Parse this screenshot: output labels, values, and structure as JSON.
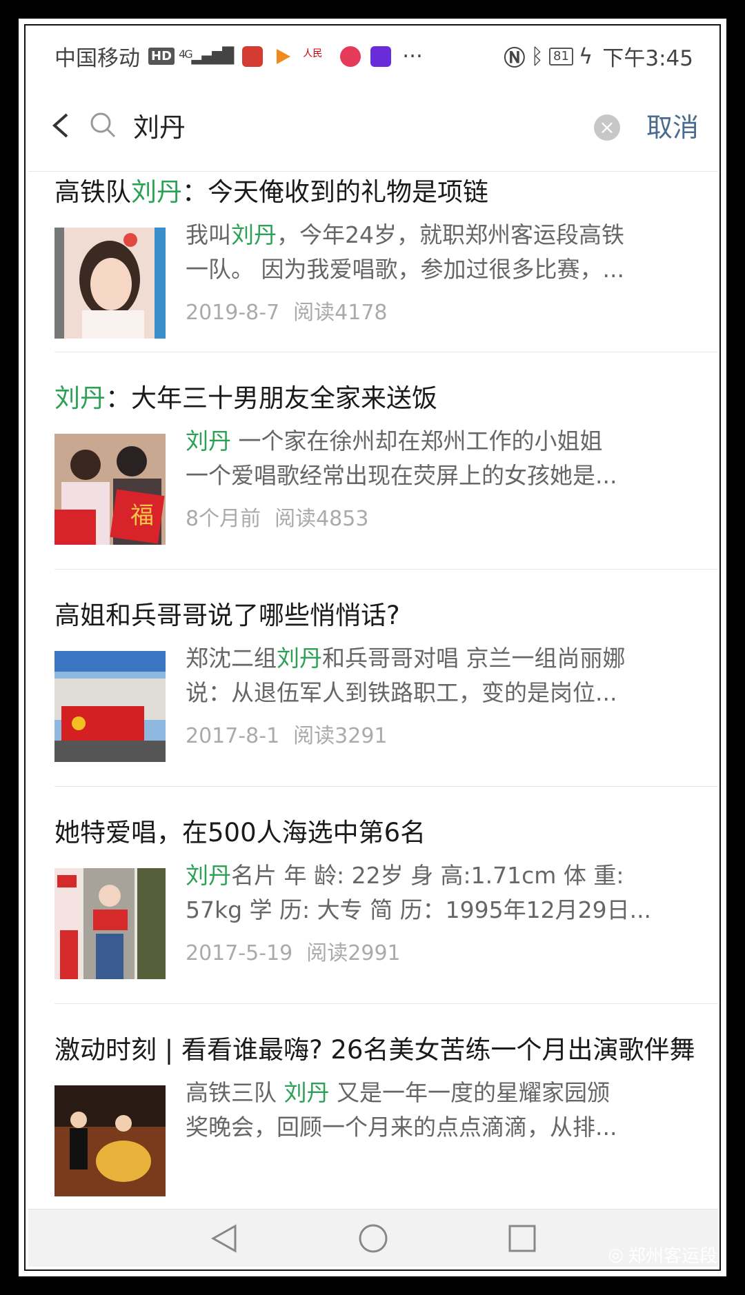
{
  "status": {
    "carrier": "中国移动",
    "hd": "HD",
    "network": "4G",
    "battery": "81",
    "time": "下午3:45",
    "more": "···"
  },
  "search": {
    "query": "刘丹",
    "clear": "×",
    "cancel": "取消"
  },
  "results": [
    {
      "title_pre": "高铁队",
      "title_hl": "刘丹",
      "title_post": "：今天俺收到的礼物是项链",
      "snip1_pre": "我叫",
      "snip1_hl": "刘丹",
      "snip1_post": "，今年24岁，就职郑州客运段高铁",
      "snip2": "一队。 因为我爱唱歌，参加过很多比赛，...",
      "date": "2019-8-7",
      "reads": "阅读4178"
    },
    {
      "title_pre": "",
      "title_hl": "刘丹",
      "title_post": "：大年三十男朋友全家来送饭",
      "snip1_pre": "",
      "snip1_hl": "刘丹",
      "snip1_post": " 一个家在徐州却在郑州工作的小姐姐",
      "snip2": "一个爱唱歌经常出现在荧屏上的女孩她是...",
      "date": "8个月前",
      "reads": "阅读4853"
    },
    {
      "title_pre": "高姐和兵哥哥说了哪些悄悄话?",
      "title_hl": "",
      "title_post": "",
      "snip1_pre": "郑沈二组",
      "snip1_hl": "刘丹",
      "snip1_post": "和兵哥哥对唱 京兰一组尚丽娜",
      "snip2": "说：从退伍军人到铁路职工，变的是岗位...",
      "date": "2017-8-1",
      "reads": "阅读3291"
    },
    {
      "title_pre": "她特爱唱，在500人海选中第6名",
      "title_hl": "",
      "title_post": "",
      "snip1_pre": "",
      "snip1_hl": "刘丹",
      "snip1_post": "名片 年 龄: 22岁 身 高:1.71cm 体 重:",
      "snip2": "57kg 学 历: 大专 简 历：1995年12月29日...",
      "date": "2017-5-19",
      "reads": "阅读2991"
    },
    {
      "title_pre": "激动时刻 | 看看谁最嗨? 26名美女苦练一个月出演歌伴舞",
      "title_hl": "",
      "title_post": "",
      "snip1_pre": "高铁三队 ",
      "snip1_hl": "刘丹",
      "snip1_post": " 又是一年一度的星耀家园颁",
      "snip2": "奖晚会，回顾一个月来的点点滴滴，从排...",
      "date": "",
      "reads": ""
    }
  ],
  "watermark": "郑州客运段"
}
